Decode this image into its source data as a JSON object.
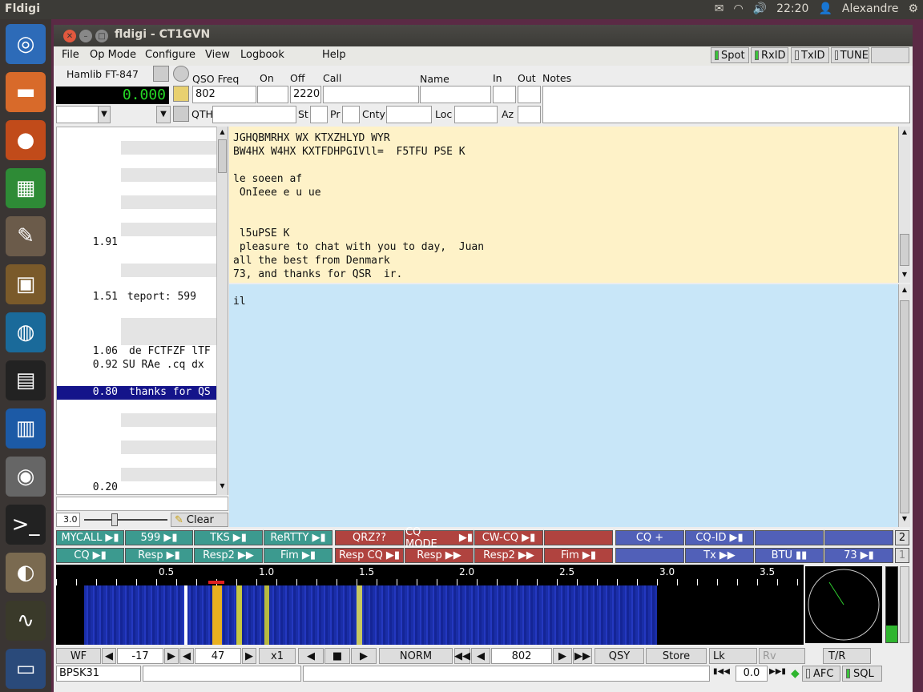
{
  "topbar": {
    "app": "Fldigi",
    "time": "22:20",
    "user": "Alexandre"
  },
  "window": {
    "title": "fldigi - CT1GVN"
  },
  "menu": [
    "File",
    "Op Mode",
    "Configure",
    "View",
    "Logbook",
    "Help"
  ],
  "toggles": {
    "spot": "Spot",
    "rxid": "RxID",
    "txid": "TxID",
    "tune": "TUNE"
  },
  "rig": {
    "name": "Hamlib FT-847",
    "freq": "0.000"
  },
  "log": {
    "qso_freq_label": "QSO Freq",
    "qso_freq": "802",
    "on_label": "On",
    "on": "",
    "off_label": "Off",
    "off": "2220",
    "call_label": "Call",
    "name_label": "Name",
    "in_label": "In",
    "out_label": "Out",
    "notes_label": "Notes",
    "qth_label": "QTH",
    "st_label": "St",
    "pr_label": "Pr",
    "cnty_label": "Cnty",
    "loc_label": "Loc",
    "az_label": "Az"
  },
  "viewer": {
    "rows": [
      {
        "freq": "1.91",
        "text": ""
      },
      {
        "freq": "1.51",
        "text": " teport: 599"
      },
      {
        "freq": "1.06",
        "text": "de FCTFZF lTF"
      },
      {
        "freq": "0.92",
        "text": "SU RAe .cq dx"
      },
      {
        "freq": "0.80",
        "text": "thanks for QS"
      },
      {
        "freq": "0.20",
        "text": ""
      }
    ],
    "squelch": "3.0",
    "clear": "Clear"
  },
  "rx_text": "JGHQBMRHX WX KTXZHLYD WYR\nBW4HX W4HX KXTFDHPGIVll=  F5TFU PSE K\n\nle soeen af\n OnIeee e u ue\n\n\n l5uPSE K\n pleasure to chat with you to day,  Juan\nall the best from Denmark\n73, and thanks for QSR  ir.",
  "tx_text": "il",
  "macros": {
    "row1": [
      "MYCALL",
      "599",
      "TKS",
      "ReRTTY",
      "QRZ??",
      "CQ MODE",
      "CW-CQ",
      "",
      "CQ +",
      "CQ-ID",
      "",
      ""
    ],
    "row2": [
      "CQ",
      "Resp",
      "Resp2",
      "Fim",
      "Resp CQ",
      "Resp",
      "Resp2",
      "Fim",
      "",
      "Tx",
      "BTU",
      "73"
    ],
    "bank1": "2",
    "bank2": "1"
  },
  "scale": [
    "0.5",
    "1.0",
    "1.5",
    "2.0",
    "2.5",
    "3.0",
    "3.5"
  ],
  "controls": {
    "wf": "WF",
    "min": "-17",
    "range": "47",
    "zoom": "x1",
    "norm": "NORM",
    "freq": "802",
    "qsy": "QSY",
    "store": "Store",
    "lk": "Lk",
    "rv": "Rv",
    "tr": "T/R"
  },
  "status": {
    "mode": "BPSK31",
    "afc_val": "0.0",
    "afc": "AFC",
    "sql": "SQL"
  },
  "colors": {
    "rx_bg": "#fef2c8",
    "tx_bg": "#c8e6f8",
    "macro_green": "#3c9a8f",
    "macro_red": "#b0433f",
    "macro_blue": "#5160b8"
  },
  "signal_level": 0.22
}
